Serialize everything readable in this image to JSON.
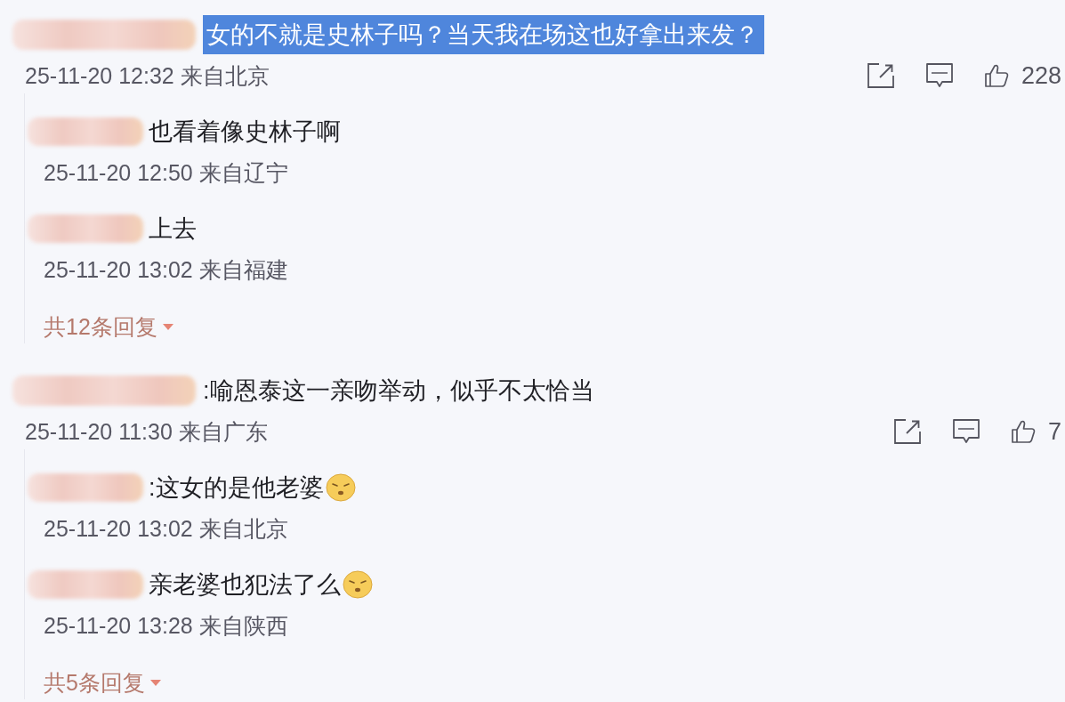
{
  "comments": [
    {
      "text": "女的不就是史林子吗？当天我在场这也好拿出来发？",
      "highlighted": true,
      "meta": "25-11-20 12:32 来自北京",
      "likes": "228",
      "replies": [
        {
          "text": "也看着像史林子啊",
          "emoji": false,
          "meta": "25-11-20 12:50 来自辽宁"
        },
        {
          "text": "上去",
          "emoji": false,
          "meta": "25-11-20 13:02 来自福建"
        }
      ],
      "more_replies": "共12条回复"
    },
    {
      "text": ":喻恩泰这一亲吻举动，似乎不太恰当",
      "highlighted": false,
      "meta": "25-11-20 11:30 来自广东",
      "likes": "7",
      "replies": [
        {
          "text": ":这女的是他老婆",
          "emoji": true,
          "meta": "25-11-20 13:02 来自北京"
        },
        {
          "text": "亲老婆也犯法了么",
          "emoji": true,
          "meta": "25-11-20 13:28 来自陕西"
        }
      ],
      "more_replies": "共5条回复"
    }
  ]
}
